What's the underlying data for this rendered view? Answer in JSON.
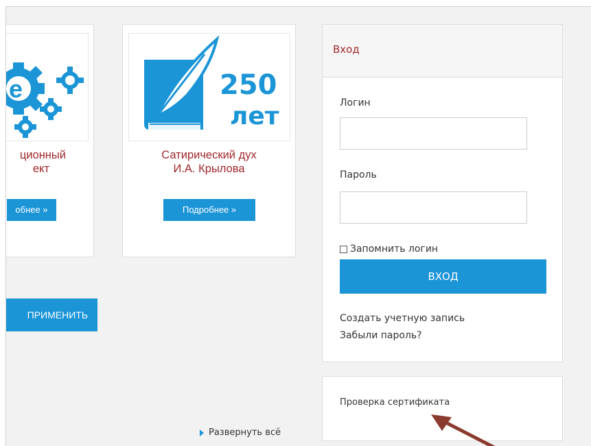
{
  "cards": [
    {
      "title_line1": "ционный",
      "title_line2": "ект",
      "more_label": "обнее »"
    },
    {
      "logo_number": "250",
      "logo_word": "лет",
      "title_line1": "Сатирический дух",
      "title_line2": "И.А. Крылова",
      "more_label": "Подробнее »"
    }
  ],
  "filter": {
    "apply_label": "ПРИМЕНИТЬ"
  },
  "login": {
    "title": "Вход",
    "login_label": "Логин",
    "login_value": "",
    "password_label": "Пароль",
    "password_value": "",
    "remember_label": "Запомнить логин",
    "submit_label": "ВХОД",
    "create_account": "Создать учетную запись",
    "forgot_password": "Забыли пароль?"
  },
  "certificate": {
    "label": "Проверка сертификата"
  },
  "expand_all": "Развернуть всё",
  "colors": {
    "accent": "#1c95d7",
    "title_red": "#a0282c",
    "arrow": "#8b3a2e"
  }
}
